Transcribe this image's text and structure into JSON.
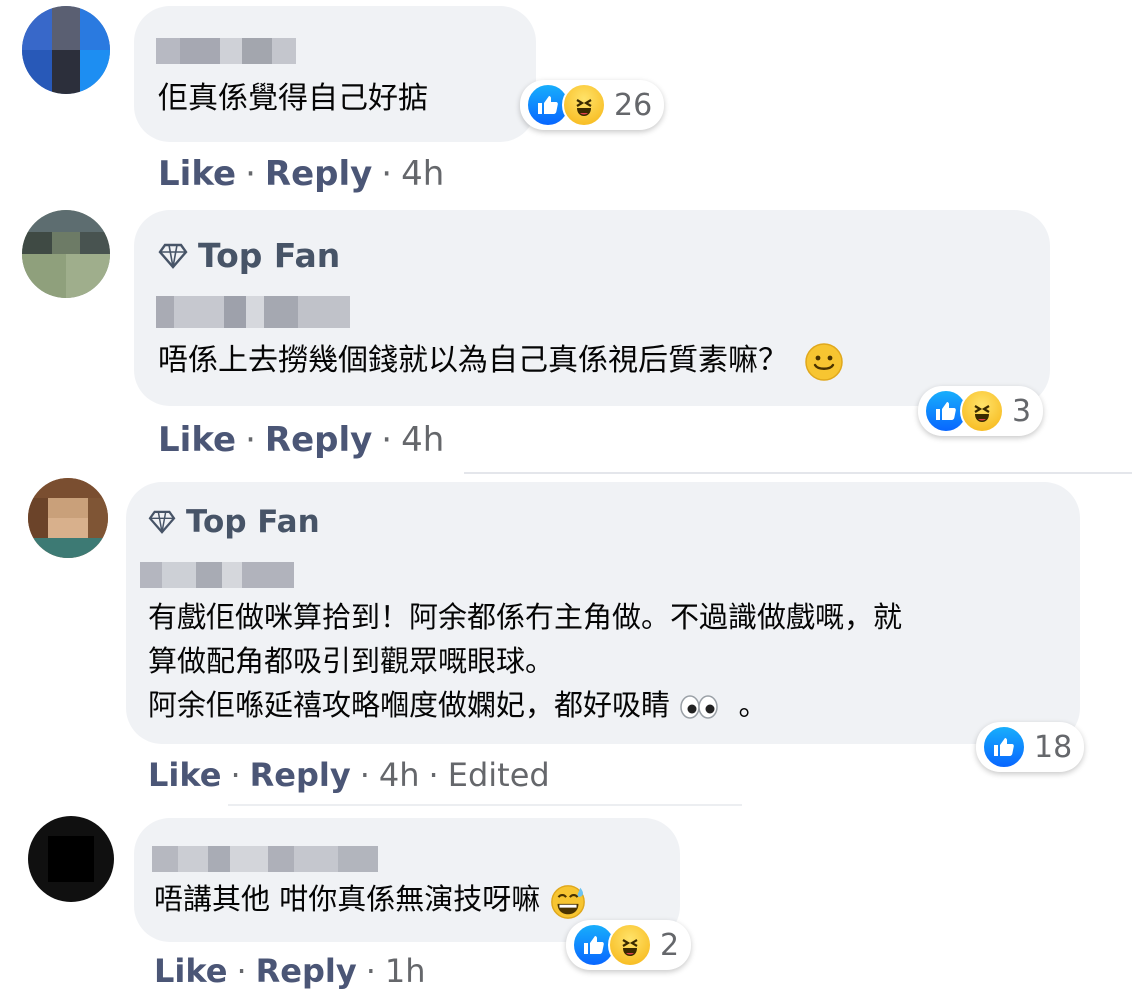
{
  "comments": [
    {
      "top_fan": "",
      "text": "佢真係覺得自己好掂",
      "reactions": {
        "icons": [
          "like-icon",
          "haha-icon"
        ],
        "count": "26"
      },
      "actions": {
        "like": "Like",
        "reply": "Reply",
        "time": "4h",
        "edited": ""
      }
    },
    {
      "top_fan": "Top Fan",
      "text": "唔係上去撈幾個錢就以為自己真係視后質素嘛？",
      "trailing_emoji": "smile-emoji",
      "reactions": {
        "icons": [
          "like-icon",
          "haha-icon"
        ],
        "count": "3"
      },
      "actions": {
        "like": "Like",
        "reply": "Reply",
        "time": "4h",
        "edited": ""
      }
    },
    {
      "top_fan": "Top Fan",
      "lines": [
        "有戲佢做咪算拾到！阿余都係冇主角做。不過識做戲嘅，就",
        "算做配角都吸引到觀眾嘅眼球。",
        "阿余佢喺延禧攻略嗰度做嫻妃，都好吸睛",
        "。"
      ],
      "trailing_emoji": "eyes-emoji",
      "reactions": {
        "icons": [
          "like-icon"
        ],
        "count": "18"
      },
      "actions": {
        "like": "Like",
        "reply": "Reply",
        "time": "4h",
        "edited": "Edited"
      }
    },
    {
      "top_fan": "",
      "text": "唔講其他 咁你真係無演技呀嘛",
      "trailing_emoji": "sweat-smile-emoji",
      "reactions": {
        "icons": [
          "like-icon",
          "haha-icon"
        ],
        "count": "2"
      },
      "actions": {
        "like": "Like",
        "reply": "Reply",
        "time": "1h",
        "edited": ""
      }
    }
  ],
  "separator": "·",
  "colors": {
    "bubble": "#f0f2f5",
    "action_text": "#4b5676",
    "meta_text": "#65676b",
    "like_blue": "#0866ff",
    "haha_yellow": "#f6b413"
  }
}
